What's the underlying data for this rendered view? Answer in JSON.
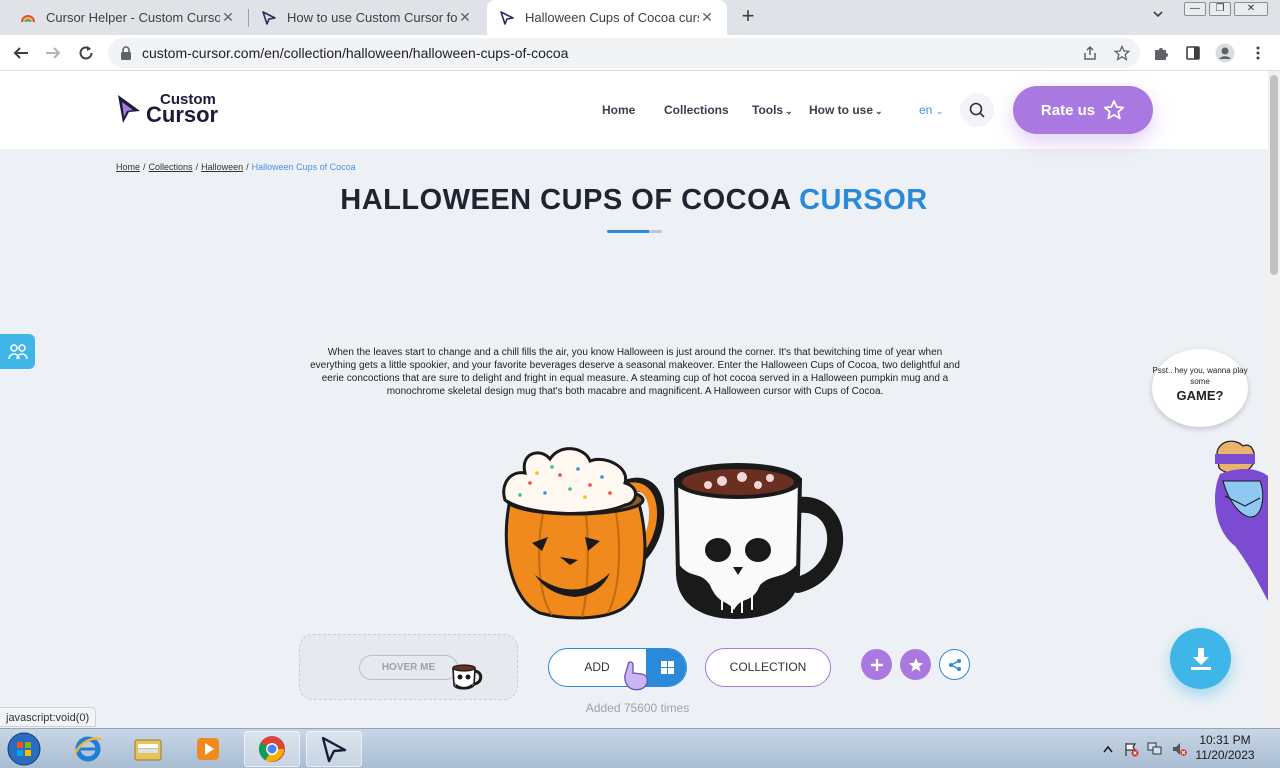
{
  "browser": {
    "tabs": [
      {
        "title": "Cursor Helper - Custom Cursor",
        "icon": "rainbow-cursor-icon"
      },
      {
        "title": "How to use Custom Cursor for W",
        "icon": "cursor-arrow-icon"
      },
      {
        "title": "Halloween Cups of Cocoa cursor",
        "icon": "cursor-arrow-icon",
        "active": true
      }
    ],
    "url": "custom-cursor.com/en/collection/halloween/halloween-cups-of-cocoa",
    "status_text": "javascript:void(0)"
  },
  "site": {
    "logo_line1": "Custom",
    "logo_line2": "Cursor",
    "nav": {
      "home": "Home",
      "collections": "Collections",
      "tools": "Tools",
      "how_to_use": "How to use",
      "lang": "en"
    },
    "rate_label": "Rate us"
  },
  "breadcrumb": {
    "home": "Home",
    "collections": "Collections",
    "halloween": "Halloween",
    "current": "Halloween Cups of Cocoa",
    "separator": "/"
  },
  "page": {
    "title_main": "HALLOWEEN CUPS OF COCOA",
    "title_accent": "CURSOR",
    "description": "When the leaves start to change and a chill fills the air, you know Halloween is just around the corner. It's that bewitching time of year when everything gets a little spookier, and your favorite beverages deserve a seasonal makeover. Enter the Halloween Cups of Cocoa, two delightful and eerie concoctions that are sure to delight and fright in equal measure. A steaming cup of hot cocoa served in a Halloween pumpkin mug and a monochrome skeletal design mug that's both macabre and magnificent. A Halloween cursor with Cups of Cocoa.",
    "hover_label": "HOVER ME",
    "add_label": "ADD",
    "collection_label": "COLLECTION",
    "added_text": "Added 75600 times",
    "bubble_small": "Psst.. hey you, wanna play some",
    "bubble_big": "GAME?"
  },
  "colors": {
    "accent_blue": "#2b89d9",
    "accent_purple": "#a978e0",
    "download_blue": "#3fb5e8"
  },
  "taskbar": {
    "time": "10:31 PM",
    "date": "11/20/2023"
  }
}
